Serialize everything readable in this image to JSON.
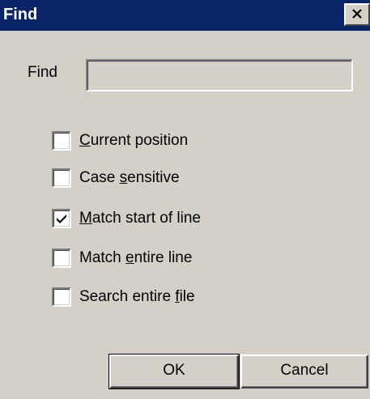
{
  "window": {
    "title": "Find",
    "close_icon": "close-icon"
  },
  "find": {
    "label": "Find",
    "value": ""
  },
  "options": [
    {
      "before": "",
      "underline": "C",
      "after": "urrent position",
      "checked": false
    },
    {
      "before": "Case ",
      "underline": "s",
      "after": "ensitive",
      "checked": false
    },
    {
      "before": "",
      "underline": "M",
      "after": "atch start of line",
      "checked": true
    },
    {
      "before": "Match ",
      "underline": "e",
      "after": "ntire line",
      "checked": false
    },
    {
      "before": "Search entire ",
      "underline": "f",
      "after": "ile",
      "checked": false
    }
  ],
  "buttons": {
    "ok_label": "OK",
    "cancel_label": "Cancel"
  },
  "colors": {
    "titlebar": "#0a246a",
    "face": "#d4d0c8"
  }
}
